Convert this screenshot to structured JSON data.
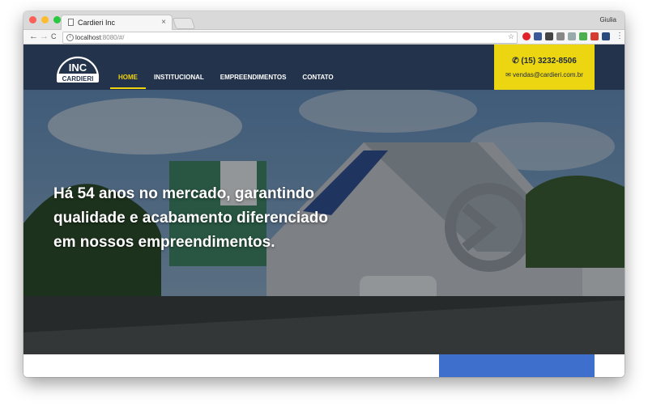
{
  "browser": {
    "tab_title": "Cardieri Inc",
    "tab_close": "×",
    "profile_name": "Giulia",
    "url_host": "localhost",
    "url_rest": ":8080/#/",
    "nav_back": "←",
    "nav_forward": "→",
    "nav_reload": "C",
    "bookmark_star": "☆",
    "menu_dots": "⋮"
  },
  "site": {
    "logo_top": "INC",
    "logo_bottom": "CARDIERI",
    "nav": [
      {
        "label": "HOME",
        "active": true
      },
      {
        "label": "INSTITUCIONAL",
        "active": false
      },
      {
        "label": "EMPREENDIMENTOS",
        "active": false
      },
      {
        "label": "CONTATO",
        "active": false
      }
    ],
    "contact": {
      "phone": "(15) 3232-8506",
      "email": "vendas@cardieri.com.br"
    },
    "hero": {
      "line1": "Há 54 anos no mercado, garantindo",
      "line2": "qualidade e acabamento diferenciado",
      "line3": "em nossos empreendimentos."
    }
  },
  "colors": {
    "header_bg": "#23334b",
    "accent_yellow": "#ecd511",
    "nav_active": "#f1d20f",
    "panel_blue": "#3e6fcc"
  },
  "icons": {
    "phone": "phone-icon",
    "email": "envelope-icon",
    "info": "info-icon",
    "star": "star-icon"
  }
}
